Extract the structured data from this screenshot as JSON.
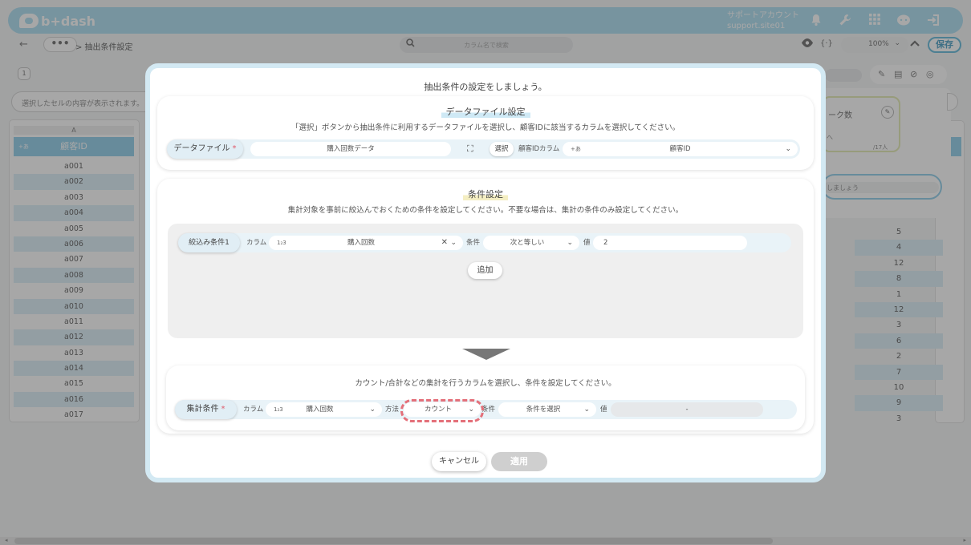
{
  "app": {
    "logo": "b+dash",
    "account_name": "サポートアカウント",
    "account_id": "support.site01"
  },
  "toolbar": {
    "more": "•••",
    "breadcrumb": "> 抽出条件設定",
    "search_placeholder": "カラム名で検索",
    "zoom": "100%",
    "save_label": "保存"
  },
  "sheet": {
    "tab_number": "1",
    "cell_display_placeholder": "選択したセルの内容が表示されます。",
    "column_letter": "A",
    "id_header": "顧客ID",
    "id_type_tag": "+あ",
    "ids": [
      "a001",
      "a002",
      "a003",
      "a004",
      "a005",
      "a006",
      "a007",
      "a008",
      "a009",
      "a010",
      "a011",
      "a012",
      "a013",
      "a014",
      "a015",
      "a016",
      "a017"
    ],
    "right_values": [
      "5",
      "4",
      "12",
      "8",
      "1",
      "12",
      "3",
      "6",
      "2",
      "7",
      "10",
      "9",
      "3"
    ]
  },
  "side_panel": {
    "count_label": "ーク数",
    "count_value": "/17人",
    "caret": "へ",
    "hint": "しましょう"
  },
  "modal": {
    "title": "抽出条件の設定をしましょう。",
    "data_file_section": {
      "title": "データファイル設定",
      "description": "「選択」ボタンから抽出条件に利用するデータファイルを選択し、顧客IDに該当するカラムを選択してください。",
      "label": "データファイル",
      "required": "*",
      "file_value": "購入回数データ",
      "select_button": "選択",
      "customer_id_label": "顧客IDカラム",
      "customer_id_type": "+あ",
      "customer_id_value": "顧客ID"
    },
    "condition_section": {
      "title": "条件設定",
      "description": "集計対象を事前に絞込んでおくための条件を設定してください。不要な場合は、集計の条件のみ設定してください。",
      "filter_label": "絞込み条件1",
      "column_label": "カラム",
      "column_type": "1₂3",
      "column_value": "購入回数",
      "condition_label": "条件",
      "condition_value": "次と等しい",
      "value_label": "値",
      "value": "2",
      "add_button": "追加"
    },
    "aggregate_section": {
      "description": "カウント/合計などの集計を行うカラムを選択し、条件を設定してください。",
      "label": "集計条件",
      "required": "*",
      "column_label": "カラム",
      "column_type": "1₂3",
      "column_value": "購入回数",
      "method_label": "方法",
      "method_value": "カウント",
      "condition_label": "条件",
      "condition_placeholder": "条件を選択",
      "value_label": "値",
      "value_placeholder": "-"
    },
    "cancel_button": "キャンセル",
    "apply_button": "適用"
  }
}
